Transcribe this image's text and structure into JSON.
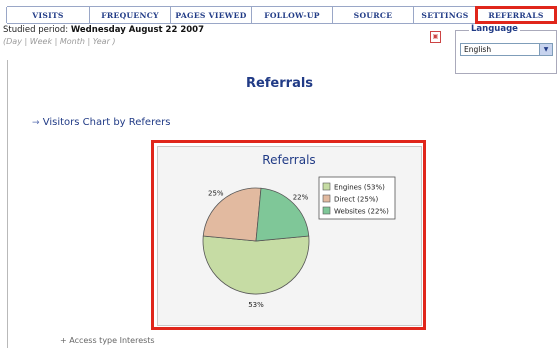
{
  "tabs": [
    {
      "label": "Visits"
    },
    {
      "label": "Frequency"
    },
    {
      "label": "Pages Viewed"
    },
    {
      "label": "Follow-up"
    },
    {
      "label": "Source"
    },
    {
      "label": "Settings"
    },
    {
      "label": "Referrals"
    }
  ],
  "period": {
    "prefix": "Studied period: ",
    "value": "Wednesday August 22 2007",
    "options": [
      "Day",
      "Week",
      "Month",
      "Year"
    ]
  },
  "language": {
    "title": "Language",
    "selected": "English"
  },
  "page_title": "Referrals",
  "section_link": "Visitors Chart by Referers",
  "bottom_link": "+ Access type Interests",
  "icons": {
    "pdf": "pdf-icon",
    "select_arrow": "chevron-down-icon",
    "link_arrow": "arrow-right-icon"
  },
  "colors": {
    "accent": "#213b86",
    "highlight": "#e0261b"
  },
  "chart_data": {
    "type": "pie",
    "title": "Referrals",
    "slices": [
      {
        "label": "Engines (53%)",
        "value": 53,
        "data_label": "53%",
        "color": "#c6dca4"
      },
      {
        "label": "Direct (25%)",
        "value": 25,
        "data_label": "25%",
        "color": "#e2baa0"
      },
      {
        "label": "Websites (22%)",
        "value": 22,
        "data_label": "22%",
        "color": "#7fc798"
      }
    ],
    "legend_position": "right"
  }
}
